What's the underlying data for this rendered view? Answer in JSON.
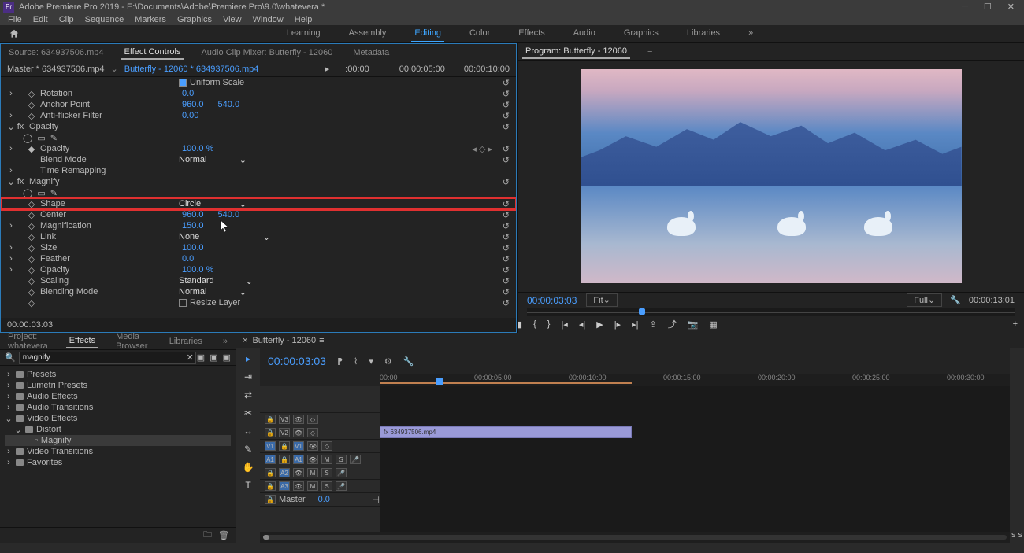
{
  "app": {
    "title": "Adobe Premiere Pro 2019 - E:\\Documents\\Adobe\\Premiere Pro\\9.0\\whatevera *",
    "logo": "Pr"
  },
  "menu": [
    "File",
    "Edit",
    "Clip",
    "Sequence",
    "Markers",
    "Graphics",
    "View",
    "Window",
    "Help"
  ],
  "workspaces": [
    "Learning",
    "Assembly",
    "Editing",
    "Color",
    "Effects",
    "Audio",
    "Graphics",
    "Libraries"
  ],
  "workspace_active": "Editing",
  "top_left_tabs": [
    "Source: 634937506.mp4",
    "Effect Controls",
    "Audio Clip Mixer: Butterfly - 12060",
    "Metadata"
  ],
  "top_left_active": "Effect Controls",
  "master_label": "Master * 634937506.mp4",
  "clip_label": "Butterfly - 12060 * 634937506.mp4",
  "ruler_marks": [
    ":00:00",
    "00:00:05:00",
    "00:00:10:00"
  ],
  "effects": {
    "uniform_scale": "Uniform Scale",
    "rotation": {
      "label": "Rotation",
      "value": "0.0"
    },
    "anchor": {
      "label": "Anchor Point",
      "value1": "960.0",
      "value2": "540.0"
    },
    "antiflicker": {
      "label": "Anti-flicker Filter",
      "value": "0.00"
    },
    "opacity_group": "Opacity",
    "opacity": {
      "label": "Opacity",
      "value": "100.0 %"
    },
    "blend": {
      "label": "Blend Mode",
      "value": "Normal"
    },
    "timeremap": "Time Remapping",
    "magnify_group": "Magnify",
    "shape": {
      "label": "Shape",
      "value": "Circle"
    },
    "center": {
      "label": "Center",
      "value1": "960.0",
      "value2": "540.0"
    },
    "magnification": {
      "label": "Magnification",
      "value": "150.0"
    },
    "link": {
      "label": "Link",
      "value": "None"
    },
    "size": {
      "label": "Size",
      "value": "100.0"
    },
    "feather": {
      "label": "Feather",
      "value": "0.0"
    },
    "mopacity": {
      "label": "Opacity",
      "value": "100.0 %"
    },
    "scaling": {
      "label": "Scaling",
      "value": "Standard"
    },
    "blending": {
      "label": "Blending Mode",
      "value": "Normal"
    },
    "resize": "Resize Layer"
  },
  "effect_tc": "00:00:03:03",
  "program": {
    "title": "Program: Butterfly - 12060",
    "tc_left": "00:00:03:03",
    "fit": "Fit",
    "full": "Full",
    "tc_right": "00:00:13:01"
  },
  "project": {
    "tabs": [
      "Project: whatevera",
      "Effects",
      "Media Browser",
      "Libraries"
    ],
    "active": "Effects",
    "search": "magnify",
    "tree": [
      {
        "label": "Presets",
        "indent": 0
      },
      {
        "label": "Lumetri Presets",
        "indent": 0
      },
      {
        "label": "Audio Effects",
        "indent": 0
      },
      {
        "label": "Audio Transitions",
        "indent": 0
      },
      {
        "label": "Video Effects",
        "indent": 0,
        "open": true
      },
      {
        "label": "Distort",
        "indent": 1,
        "open": true
      },
      {
        "label": "Magnify",
        "indent": 2,
        "sel": true,
        "leaf": true
      },
      {
        "label": "Video Transitions",
        "indent": 0
      },
      {
        "label": "Favorites",
        "indent": 0
      }
    ]
  },
  "timeline": {
    "title": "Butterfly - 12060",
    "tc": "00:00:03:03",
    "ruler": [
      "00:00",
      "00:00:05:00",
      "00:00:10:00",
      "00:00:15:00",
      "00:00:20:00",
      "00:00:25:00",
      "00:00:30:00"
    ],
    "clip_name": "fx  634937506.mp4",
    "tracks_v": [
      "V3",
      "V2",
      "V1"
    ],
    "tracks_a": [
      "A1",
      "A2",
      "A3"
    ],
    "master": {
      "label": "Master",
      "value": "0.0"
    }
  }
}
